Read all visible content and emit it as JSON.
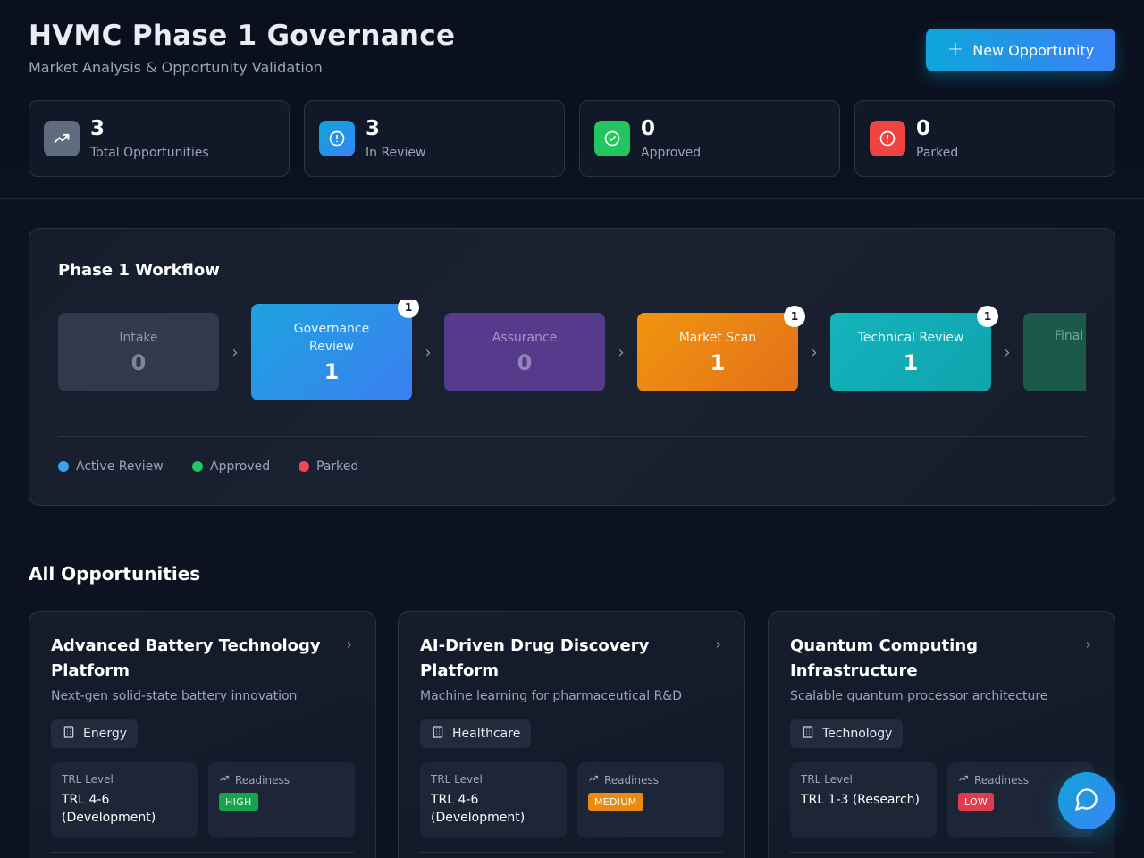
{
  "header": {
    "title": "HVMC Phase 1 Governance",
    "subtitle": "Market Analysis & Opportunity Validation",
    "new_button_label": "New Opportunity"
  },
  "stats": [
    {
      "value": "3",
      "label": "Total Opportunities",
      "icon": "trending-up-icon",
      "color": "#5f6b7e"
    },
    {
      "value": "3",
      "label": "In Review",
      "icon": "alert-circle-icon",
      "color": "#3b82f6"
    },
    {
      "value": "0",
      "label": "Approved",
      "icon": "check-circle-icon",
      "color": "#22c55e"
    },
    {
      "value": "0",
      "label": "Parked",
      "icon": "alert-circle-icon",
      "color": "#ef4444"
    }
  ],
  "workflow": {
    "title": "Phase 1 Workflow",
    "stages": [
      {
        "name": "Intake",
        "count": "0",
        "badge": "",
        "color": "#313a4b"
      },
      {
        "name": "Governance Review",
        "count": "1",
        "badge": "1",
        "color": "#2f8be6"
      },
      {
        "name": "Assurance",
        "count": "0",
        "badge": "",
        "color": "#563a8c"
      },
      {
        "name": "Market Scan",
        "count": "1",
        "badge": "1",
        "color": "#ee8a14"
      },
      {
        "name": "Technical Review",
        "count": "1",
        "badge": "1",
        "color": "#16b0b8"
      },
      {
        "name": "Final",
        "count": "",
        "badge": "",
        "color": "#1b5a4a"
      }
    ],
    "legend": [
      {
        "label": "Active Review",
        "color": "#3b9ff0"
      },
      {
        "label": "Approved",
        "color": "#22c55e"
      },
      {
        "label": "Parked",
        "color": "#f04459"
      }
    ]
  },
  "opportunities_section": {
    "title": "All Opportunities",
    "trl_label": "TRL Level",
    "readiness_label": "Readiness",
    "cards": [
      {
        "title": "Advanced Battery Technology Platform",
        "description": "Next-gen solid-state battery innovation",
        "sector": "Energy",
        "trl": "TRL 4-6 (Development)",
        "readiness": "HIGH",
        "readiness_color": "#16a34a"
      },
      {
        "title": "AI-Driven Drug Discovery Platform",
        "description": "Machine learning for pharmaceutical R&D",
        "sector": "Healthcare",
        "trl": "TRL 4-6 (Development)",
        "readiness": "MEDIUM",
        "readiness_color": "#ea8a12"
      },
      {
        "title": "Quantum Computing Infrastructure",
        "description": "Scalable quantum processor architecture",
        "sector": "Technology",
        "trl": "TRL 1-3 (Research)",
        "readiness": "LOW",
        "readiness_color": "#e23a4e"
      }
    ]
  },
  "chat": {
    "icon": "chat-bubble-icon"
  }
}
